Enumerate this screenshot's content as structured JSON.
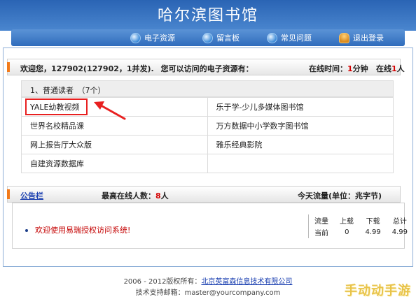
{
  "header": {
    "title": "哈尔滨图书馆"
  },
  "nav": {
    "items": [
      {
        "label": "电子资源",
        "icon": "globe-icon"
      },
      {
        "label": "留言板",
        "icon": "globe-icon"
      },
      {
        "label": "常见问题",
        "icon": "globe-icon"
      },
      {
        "label": "退出登录",
        "icon": "user-icon"
      }
    ]
  },
  "welcome": {
    "prefix": "欢迎您，",
    "user": "127902(127902，1并发).",
    "resources_label": "您可以访问的电子资源有：",
    "online_time_label": "在线时间：",
    "online_time_value": "1",
    "online_time_unit": "分钟",
    "online_count_label": "在线",
    "online_count_value": "1",
    "online_count_unit": "人"
  },
  "resources": {
    "group_title": "1、普通读者　（7个）",
    "rows": [
      [
        "YALE幼教视频",
        "乐于学-少儿多媒体图书馆"
      ],
      [
        "世界名校精品课",
        "万方数据中小学数字图书馆"
      ],
      [
        "网上报告厅大众版",
        "雅乐经典影院"
      ],
      [
        "自建资源数据库",
        ""
      ]
    ]
  },
  "notice": {
    "title": "公告栏",
    "max_online_label": "最高在线人数：",
    "max_online_value": "8",
    "max_online_unit": "人",
    "traffic_title": "今天流量(单位：兆字节)",
    "message": "欢迎使用易瑞授权访问系统!",
    "traffic": {
      "headers": [
        "流量",
        "上载",
        "下载",
        "总计"
      ],
      "row": [
        "当前",
        "0",
        "4.99",
        "4.99"
      ]
    }
  },
  "footer": {
    "copyright_prefix": "2006 - 2012版权所有：",
    "company": "北京英富森信息技术有限公司",
    "support_label": "技术支持邮箱：",
    "support_email": "master@yourcompany.com"
  },
  "watermark": "手动动手游",
  "colors": {
    "accent": "#f27a1a",
    "highlight": "#d40000",
    "header": "#2a64b4"
  }
}
